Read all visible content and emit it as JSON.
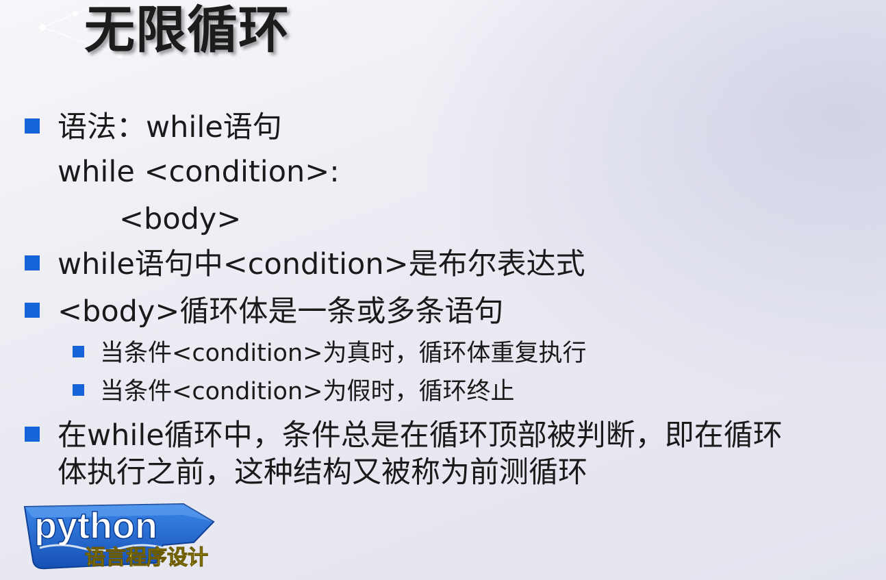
{
  "slide": {
    "title": "无限循环",
    "bullets": {
      "syntax_heading": "语法：while语句",
      "syntax_line1": "while   <condition>:",
      "syntax_line2": "<body>",
      "bullet2": "while语句中<condition>是布尔表达式",
      "bullet3": "<body>循环体是一条或多条语句",
      "sub1": "当条件<condition>为真时，循环体重复执行",
      "sub2": "当条件<condition>为假时，循环终止",
      "bullet4_line1": "在while循环中，条件总是在循环顶部被判断，即在循环",
      "bullet4_line2": "体执行之前，这种结构又被称为前测循环"
    }
  },
  "logo": {
    "word": "python",
    "subtitle": "语言程序设计"
  },
  "colors": {
    "bullet": "#1565d8",
    "logo_panel": "#1f63c7",
    "logo_subtitle": "#f3ec3c"
  }
}
